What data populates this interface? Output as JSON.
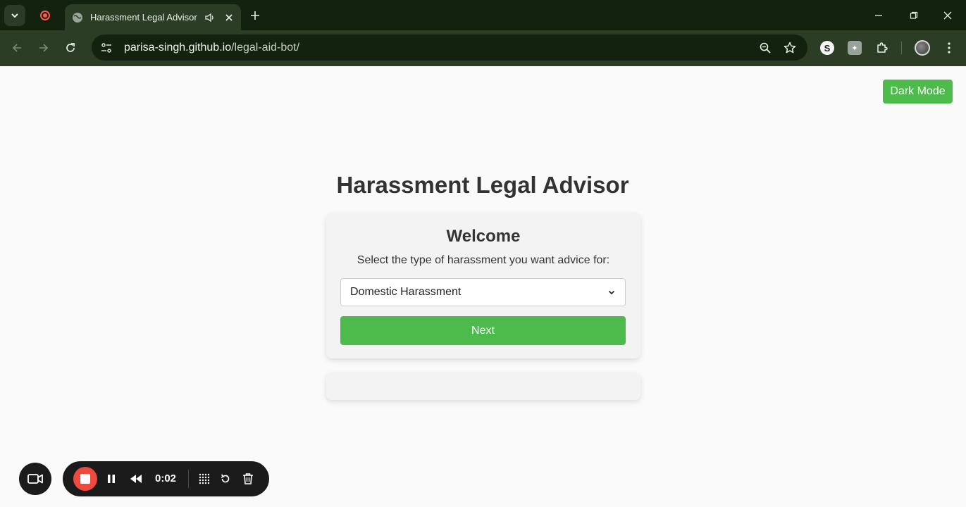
{
  "browser": {
    "tab": {
      "title": "Harassment Legal Advisor",
      "favicon": "globe-icon",
      "audio_icon": "speaker-icon"
    },
    "url": {
      "host": "parisa-singh.github.io",
      "path": "/legal-aid-bot/"
    },
    "theme": {
      "frame": "#13220f",
      "toolbar": "#2b3d25"
    }
  },
  "page": {
    "dark_mode_label": "Dark Mode",
    "title": "Harassment Legal Advisor",
    "card": {
      "heading": "Welcome",
      "prompt": "Select the type of harassment you want advice for:",
      "select_value": "Domestic Harassment",
      "next_label": "Next"
    },
    "accent": "#4cbb4c"
  },
  "recorder": {
    "time": "0:02",
    "stop_color": "#f0493d"
  }
}
